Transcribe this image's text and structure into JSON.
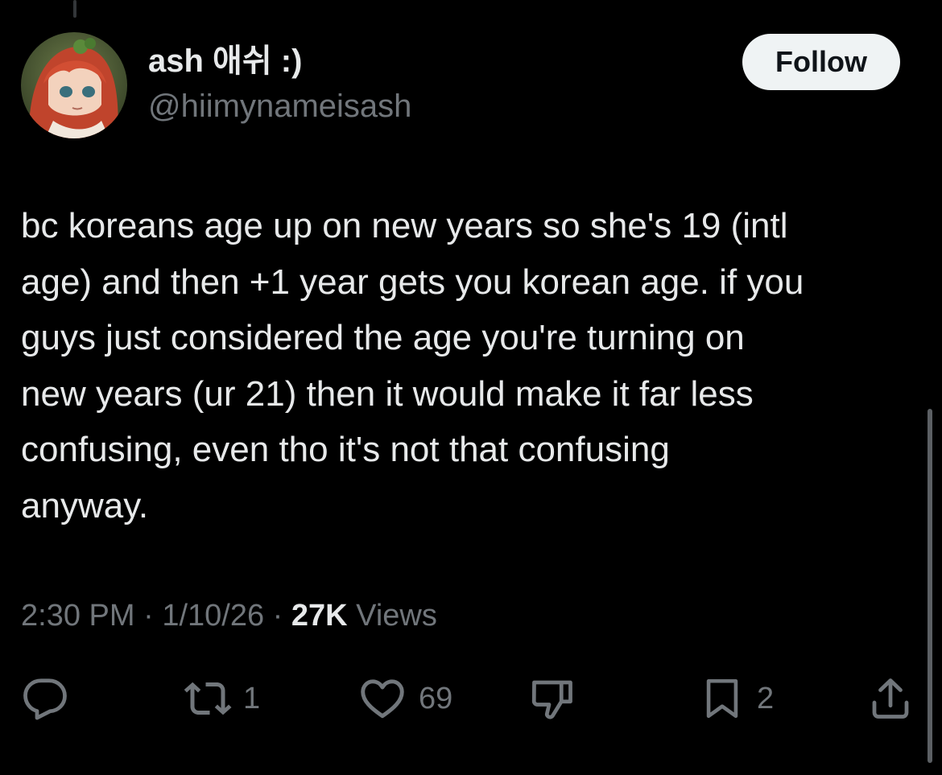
{
  "author": {
    "display_name": "ash 애쉬 :)",
    "handle": "@hiimynameisash"
  },
  "follow_button": {
    "label": "Follow"
  },
  "tweet": {
    "lines": [
      "bc koreans age up on new years so she's 19 (intl",
      "age) and then +1 year gets you korean age. if you",
      "guys just considered the age you're turning on",
      "new years (ur 21) then it would make it far less",
      "confusing, even tho it's not that confusing",
      "anyway."
    ]
  },
  "meta": {
    "time": "2:30 PM",
    "separator": "·",
    "date": "1/10/26",
    "views_count": "27K",
    "views_label": "Views"
  },
  "actions": {
    "reply": {
      "icon": "reply-icon"
    },
    "retweet": {
      "icon": "retweet-icon",
      "count": "1"
    },
    "like": {
      "icon": "heart-icon",
      "count": "69"
    },
    "dislike": {
      "icon": "thumbs-down-icon"
    },
    "bookmark": {
      "icon": "bookmark-icon",
      "count": "2"
    },
    "share": {
      "icon": "share-icon"
    }
  },
  "colors": {
    "background": "#000000",
    "primary_text": "#e7e9ea",
    "secondary_text": "#71767b",
    "follow_button_bg": "#eff3f4"
  }
}
